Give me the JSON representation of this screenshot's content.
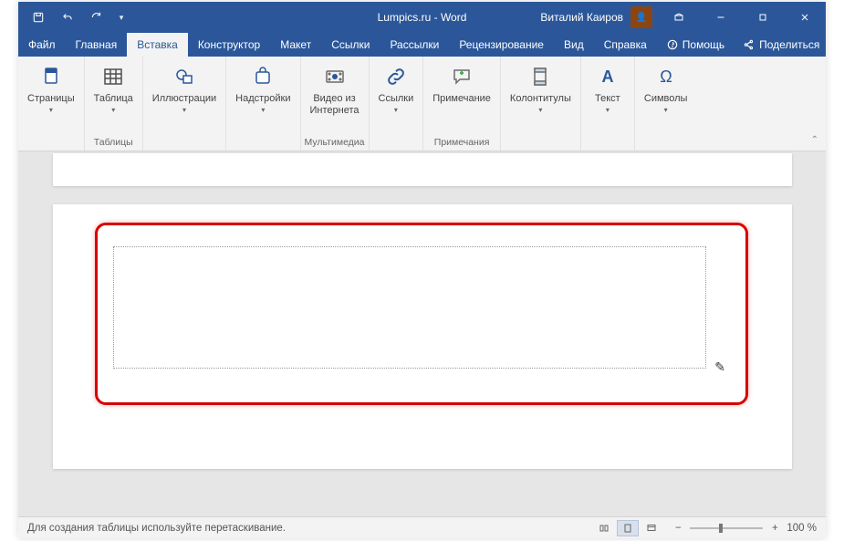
{
  "title": "Lumpics.ru  -  Word",
  "user": "Виталий Каиров",
  "tabs": {
    "file": "Файл",
    "home": "Главная",
    "insert": "Вставка",
    "design": "Конструктор",
    "layout": "Макет",
    "references": "Ссылки",
    "mailings": "Рассылки",
    "review": "Рецензирование",
    "view": "Вид",
    "help": "Справка"
  },
  "menu_right": {
    "help": "Помощь",
    "share": "Поделиться"
  },
  "ribbon": {
    "pages": {
      "btn": "Страницы",
      "group": ""
    },
    "tables": {
      "btn": "Таблица",
      "group": "Таблицы"
    },
    "illustrations": {
      "btn": "Иллюстрации",
      "group": ""
    },
    "addins": {
      "btn": "Надстройки",
      "group": ""
    },
    "media": {
      "btn": "Видео из\nИнтернета",
      "group": "Мультимедиа"
    },
    "links": {
      "btn": "Ссылки",
      "group": ""
    },
    "comments": {
      "btn": "Примечание",
      "group": "Примечания"
    },
    "headerfooter": {
      "btn": "Колонтитулы",
      "group": ""
    },
    "text": {
      "btn": "Текст",
      "group": ""
    },
    "symbols": {
      "btn": "Символы",
      "group": ""
    }
  },
  "status": {
    "message": "Для создания таблицы используйте перетаскивание.",
    "zoom": "100 %"
  },
  "colors": {
    "brand": "#2b579a",
    "annotation": "#d60000"
  }
}
